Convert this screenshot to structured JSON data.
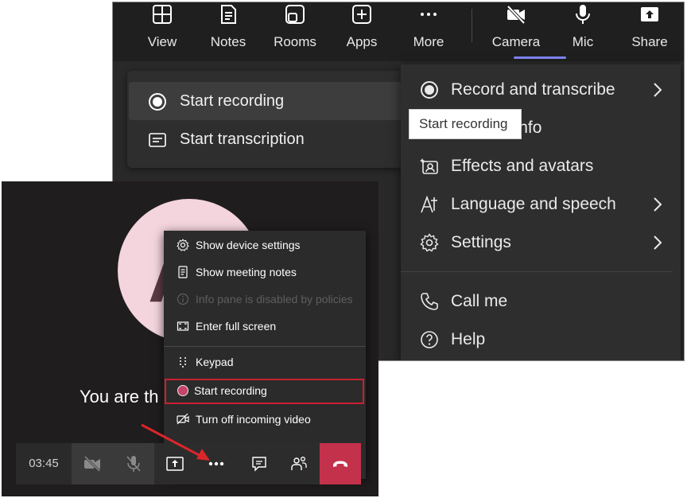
{
  "top_toolbar": {
    "view_label": "View",
    "notes_label": "Notes",
    "rooms_label": "Rooms",
    "apps_label": "Apps",
    "more_label": "More",
    "camera_label": "Camera",
    "mic_label": "Mic",
    "share_label": "Share"
  },
  "record_submenu": {
    "start_recording": "Start recording",
    "start_transcription": "Start transcription"
  },
  "tooltip": {
    "text": "Start recording"
  },
  "more_menu": {
    "record_transcribe": "Record and transcribe",
    "meeting_info": "Meeting info",
    "effects_avatars": "Effects and avatars",
    "language_speech": "Language and speech",
    "settings": "Settings",
    "call_me": "Call me",
    "help": "Help"
  },
  "classic_call": {
    "avatar_initial": "A",
    "you_are_text": "You are th",
    "timer": "03:45",
    "context_menu": {
      "show_device_settings": "Show device settings",
      "show_meeting_notes": "Show meeting notes",
      "info_pane_disabled": "Info pane is disabled by policies",
      "enter_full_screen": "Enter full screen",
      "keypad": "Keypad",
      "start_recording": "Start recording",
      "turn_off_video": "Turn off incoming video"
    }
  },
  "colors": {
    "accent_underline": "#7f85f5",
    "hangup_red": "#c4314b",
    "highlight_border": "#c82130",
    "arrow_red": "#d9262b"
  }
}
